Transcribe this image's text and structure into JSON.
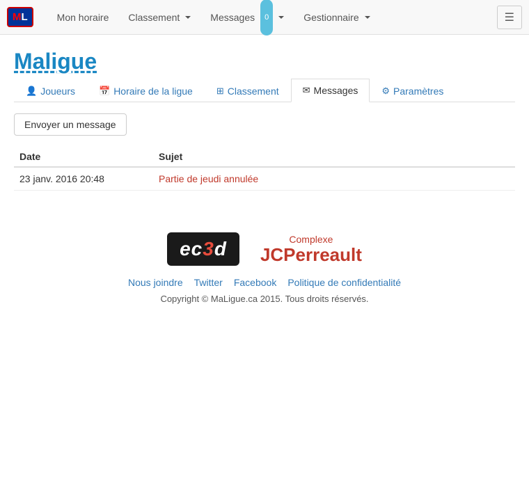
{
  "navbar": {
    "logo_text": "ML",
    "nav_items": [
      {
        "label": "Mon horaire",
        "has_dropdown": false,
        "badge": null
      },
      {
        "label": "Classement",
        "has_dropdown": true,
        "badge": null
      },
      {
        "label": "Messages",
        "has_dropdown": true,
        "badge": "0"
      },
      {
        "label": "Gestionnaire",
        "has_dropdown": true,
        "badge": null
      }
    ],
    "toggle_label": "☰"
  },
  "page": {
    "title": "Maligue",
    "tabs": [
      {
        "label": "Joueurs",
        "icon": "👤",
        "active": false
      },
      {
        "label": "Horaire de la ligue",
        "icon": "📅",
        "active": false
      },
      {
        "label": "Classement",
        "icon": "⊞",
        "active": false
      },
      {
        "label": "Messages",
        "icon": "✉",
        "active": true
      },
      {
        "label": "Paramètres",
        "icon": "⚙",
        "active": false
      }
    ],
    "send_button_label": "Envoyer un message"
  },
  "table": {
    "columns": [
      "Date",
      "Sujet"
    ],
    "rows": [
      {
        "date": "23 janv. 2016 20:48",
        "subject": "Partie de jeudi annulée"
      }
    ]
  },
  "footer": {
    "ec3d_label": "ec3d",
    "jcp_complexe": "Complexe",
    "jcp_name": "JCPerreault",
    "links": [
      {
        "label": "Nous joindre",
        "url": "#"
      },
      {
        "label": "Twitter",
        "url": "#"
      },
      {
        "label": "Facebook",
        "url": "#"
      },
      {
        "label": "Politique de confidentialité",
        "url": "#"
      }
    ],
    "copyright": "Copyright © MaLigue.ca 2015. Tous droits réservés."
  }
}
